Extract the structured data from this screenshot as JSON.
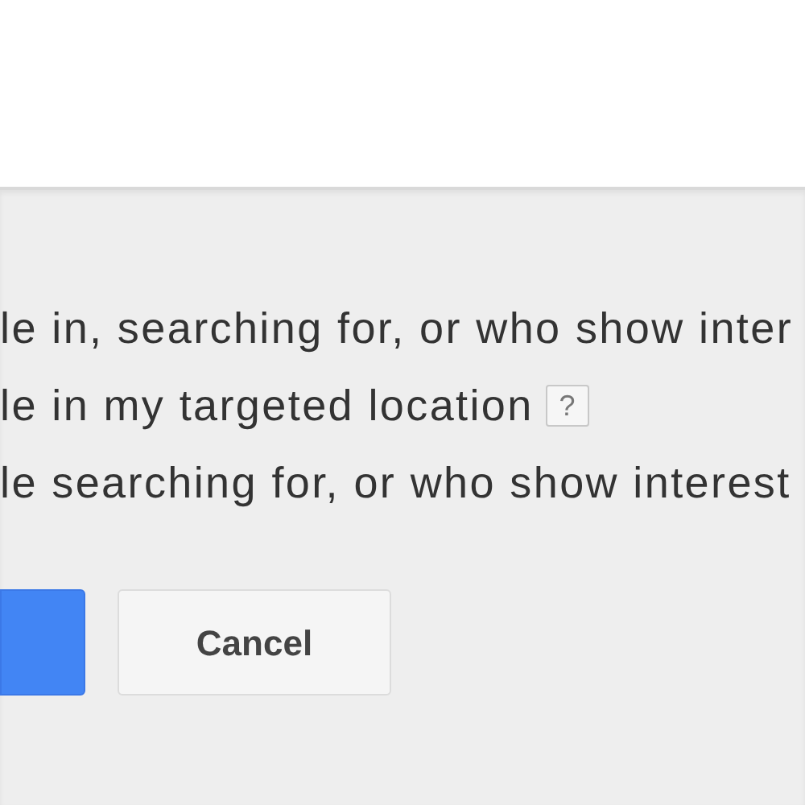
{
  "options": [
    {
      "label": "le in, searching for, or who show inter"
    },
    {
      "label": "le in my targeted location",
      "help_label": "?"
    },
    {
      "label": "le searching for, or who show interest"
    }
  ],
  "buttons": [
    {
      "kind": "primary"
    },
    {
      "kind": "secondary",
      "label": "Cancel"
    }
  ]
}
